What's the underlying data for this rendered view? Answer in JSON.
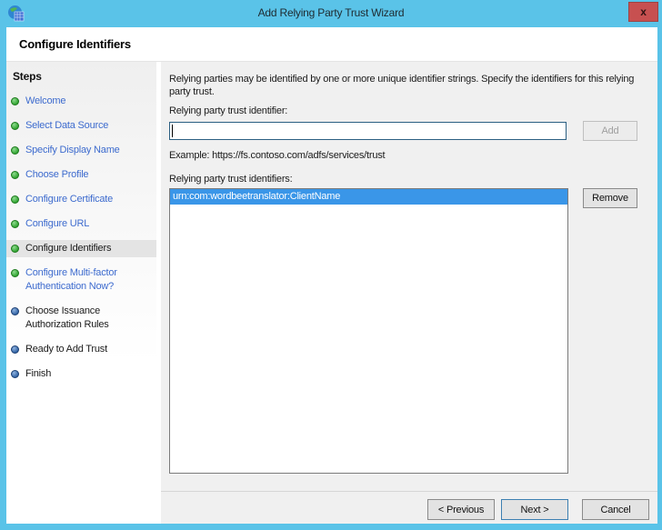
{
  "window": {
    "title": "Add Relying Party Trust Wizard",
    "close_glyph": "x"
  },
  "header": {
    "title": "Configure Identifiers"
  },
  "steps": {
    "title": "Steps",
    "items": [
      {
        "label": "Welcome",
        "state": "link",
        "dot": "green"
      },
      {
        "label": "Select Data Source",
        "state": "link",
        "dot": "green"
      },
      {
        "label": "Specify Display Name",
        "state": "link",
        "dot": "green"
      },
      {
        "label": "Choose Profile",
        "state": "link",
        "dot": "green"
      },
      {
        "label": "Configure Certificate",
        "state": "link",
        "dot": "green"
      },
      {
        "label": "Configure URL",
        "state": "link",
        "dot": "green"
      },
      {
        "label": "Configure Identifiers",
        "state": "current",
        "dot": "green"
      },
      {
        "label": "Configure Multi-factor Authentication Now?",
        "state": "link",
        "dot": "green"
      },
      {
        "label": "Choose Issuance Authorization Rules",
        "state": "future",
        "dot": "blue"
      },
      {
        "label": "Ready to Add Trust",
        "state": "future",
        "dot": "blue"
      },
      {
        "label": "Finish",
        "state": "future",
        "dot": "blue"
      }
    ]
  },
  "content": {
    "description": "Relying parties may be identified by one or more unique identifier strings. Specify the identifiers for this relying party trust.",
    "identifier_label": "Relying party trust identifier:",
    "identifier_value": "",
    "add_label": "Add",
    "example": "Example: https://fs.contoso.com/adfs/services/trust",
    "identifiers_label": "Relying party trust identifiers:",
    "identifiers": [
      "urn:com:wordbeetranslator:ClientName"
    ],
    "remove_label": "Remove"
  },
  "footer": {
    "previous_label": "< Previous",
    "next_label": "Next >",
    "cancel_label": "Cancel"
  },
  "colors": {
    "titlebar": "#5ac3e8",
    "close_button": "#c75050",
    "close_border": "#9c4444",
    "link": "#3d6bce",
    "selection": "#3a96e8",
    "dot_green": "#2da12d",
    "dot_blue": "#2d5fa1",
    "input_border": "#2b5f82",
    "next_border": "#3c7fb1"
  }
}
